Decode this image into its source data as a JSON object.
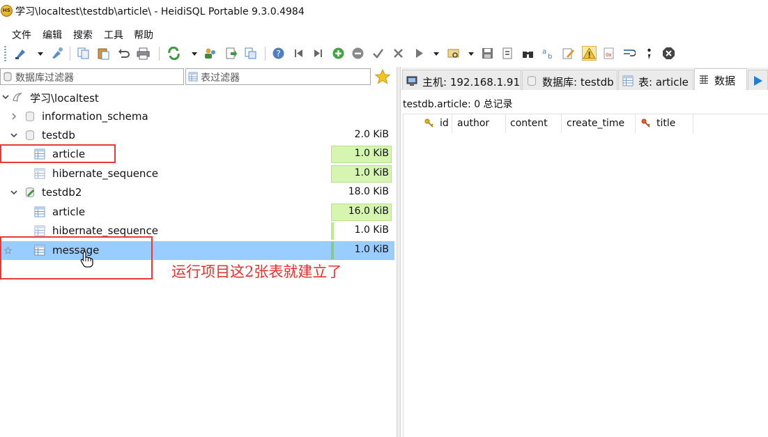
{
  "window": {
    "title": "学习\\localtest\\testdb\\article\\ - HeidiSQL Portable 9.3.0.4984",
    "app_icon_text": "HS"
  },
  "menu": [
    "文件",
    "编辑",
    "搜索",
    "工具",
    "帮助"
  ],
  "filters": {
    "database_placeholder": "数据库过滤器",
    "table_placeholder": "表过滤器"
  },
  "tree": {
    "root": "学习\\localtest",
    "items": [
      {
        "label": "information_schema",
        "size": ""
      },
      {
        "label": "testdb",
        "size": "2.0 KiB"
      },
      {
        "label": "article",
        "size": "1.0 KiB"
      },
      {
        "label": "hibernate_sequence",
        "size": "1.0 KiB"
      },
      {
        "label": "testdb2",
        "size": "18.0 KiB"
      },
      {
        "label": "article",
        "size": "16.0 KiB"
      },
      {
        "label": "hibernate_sequence",
        "size": "1.0 KiB"
      },
      {
        "label": "message",
        "size": "1.0 KiB"
      }
    ]
  },
  "tabs": [
    {
      "label": "主机: 192.168.1.91"
    },
    {
      "label": "数据库: testdb"
    },
    {
      "label": "表: article"
    },
    {
      "label": "数据"
    }
  ],
  "grid": {
    "title": "testdb.article: 0 总记录",
    "columns": [
      "id",
      "author",
      "content",
      "create_time",
      "title"
    ]
  },
  "annotation": "运行项目这2张表就建立了",
  "colors": {
    "selection": "#99ccff",
    "highlight": "#e63a3a",
    "annotation": "#e8302c",
    "size_bar": "#d6f5b0"
  }
}
